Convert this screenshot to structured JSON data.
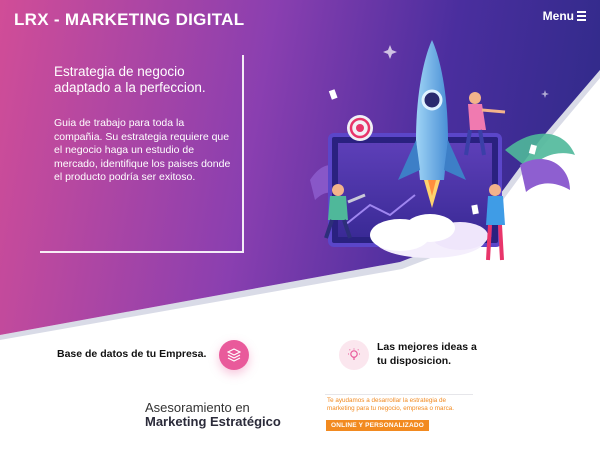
{
  "header": {
    "brand": "LRX - MARKETING DIGITAL",
    "menu_label": "Menu"
  },
  "intro": {
    "title": "Estrategia de negocio adaptado a la perfeccion.",
    "body": "Guia de trabajo para toda la compañia. Su estrategia requiere que el negocio haga un estudio de mercado, identifique los paises donde el producto podría ser exitoso."
  },
  "features": [
    {
      "label": "Base de datos de tu Empresa.",
      "icon": "layers-icon"
    },
    {
      "label": "Las mejores ideas a tu disposicion.",
      "icon": "lightbulb-icon"
    }
  ],
  "advisory": {
    "line1": "Asesoramiento en",
    "line2": "Marketing Estratégico"
  },
  "offer": {
    "text": "Te ayudamos a desarrollar la estrategia de marketing para tu negocio, empresa o marca.",
    "badge": "ONLINE Y PERSONALIZADO"
  },
  "colors": {
    "hero_pink": "#d14d97",
    "hero_purple": "#4a2e9e",
    "accent_pink": "#e95a9b",
    "accent_orange": "#f28a20"
  }
}
